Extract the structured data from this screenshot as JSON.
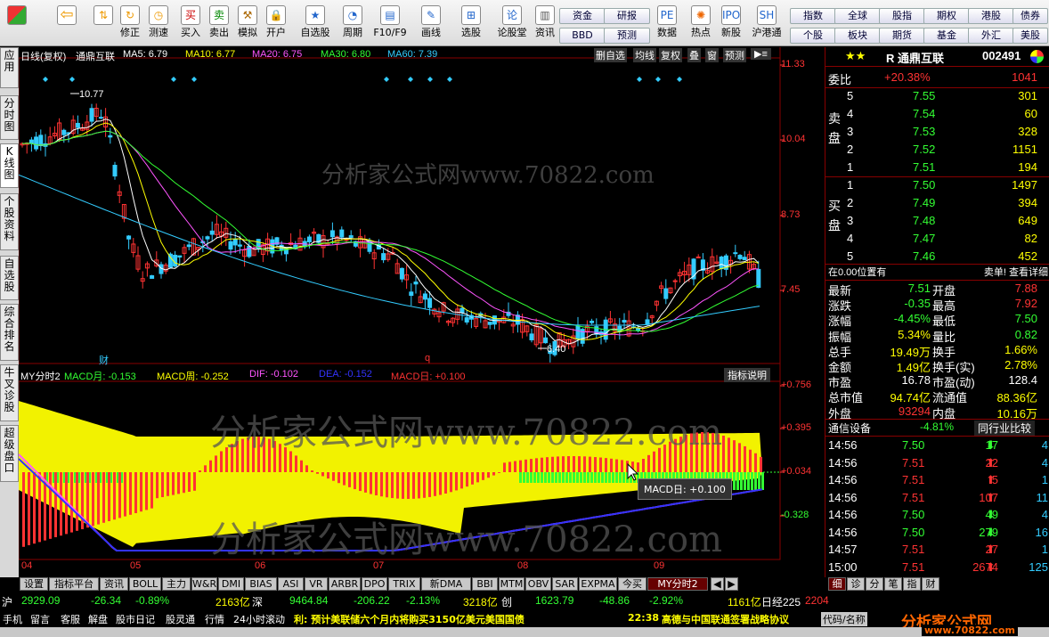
{
  "toolbar": {
    "left_buttons": [
      "修正",
      "测速",
      "买入",
      "卖出",
      "模拟",
      "开户",
      "自选股",
      "周期",
      "F10/F9",
      "画线",
      "选股",
      "论股堂",
      "资讯",
      "数据",
      "热点",
      "新股",
      "沪港通"
    ],
    "pills": [
      "资金",
      "研报",
      "BBD",
      "预测",
      "指数",
      "全球",
      "股指",
      "期权",
      "港股",
      "债券",
      "个股",
      "板块",
      "期货",
      "基金",
      "外汇",
      "美股"
    ]
  },
  "vtabs": [
    "应用",
    "分时图",
    "K线图",
    "个股资料",
    "自选股",
    "综合排名",
    "牛叉诊股",
    "超级盘口"
  ],
  "chart": {
    "header": {
      "period": "日线(复权)",
      "name": "通鼎互联",
      "ma5": "MA5: 6.79",
      "ma10": "MA10: 6.77",
      "ma20": "MA20: 6.75",
      "ma30": "MA30: 6.80",
      "ma60": "MA60: 7.39"
    },
    "toolbar": [
      "删自选",
      "均线",
      "复权",
      "叠",
      "窗",
      "预测"
    ],
    "y_labels": [
      "11.33",
      "10.04",
      "8.73",
      "7.45"
    ],
    "high_label": "10.77",
    "low_label": "6.40",
    "markers": [
      "财",
      "q"
    ],
    "ind_header": {
      "name": "MY分时2",
      "macd_month": "MACD月: -0.153",
      "macd_week": "MACD周: -0.252",
      "dif": "DIF: -0.102",
      "dea": "DEA: -0.152",
      "macd_day": "MACD日: +0.100"
    },
    "ind_btn": "指标说明",
    "ind_y": [
      "+0.756",
      "+0.395",
      "+0.034",
      "-0.328"
    ],
    "months": [
      "04",
      "05",
      "06",
      "07",
      "08",
      "09"
    ],
    "tooltip": "MACD日: +0.100",
    "watermark": "分析家公式网www.70822.com"
  },
  "chart_data": {
    "type": "candlestick",
    "title": "通鼎互联",
    "y_range": [
      6.4,
      11.33
    ],
    "months": [
      "04",
      "05",
      "06",
      "07",
      "08",
      "09"
    ],
    "high": 10.77,
    "low": 6.4,
    "ma": {
      "MA5": 6.79,
      "MA10": 6.77,
      "MA20": 6.75,
      "MA30": 6.8,
      "MA60": 7.39
    },
    "indicator": {
      "name": "MY分时2",
      "MACD月": -0.153,
      "MACD周": -0.252,
      "DIF": -0.102,
      "DEA": -0.152,
      "MACD日": 0.1,
      "y_range": [
        -0.328,
        0.756
      ]
    }
  },
  "quote": {
    "title": "R 通鼎互联",
    "code": "002491",
    "webi_label": "委比",
    "webi": "+20.38%",
    "webi_diff": "1041",
    "sell": [
      [
        "5",
        "7.55",
        "301"
      ],
      [
        "4",
        "7.54",
        "60"
      ],
      [
        "3",
        "7.53",
        "328"
      ],
      [
        "2",
        "7.52",
        "1151"
      ],
      [
        "1",
        "7.51",
        "194"
      ]
    ],
    "buy": [
      [
        "1",
        "7.50",
        "1497"
      ],
      [
        "2",
        "7.49",
        "394"
      ],
      [
        "3",
        "7.48",
        "649"
      ],
      [
        "4",
        "7.47",
        "82"
      ],
      [
        "5",
        "7.46",
        "452"
      ]
    ],
    "sell_label": "卖盘",
    "buy_label": "买盘",
    "pos_text": "在0.00位置有",
    "pos_right": "卖单! 查看详细",
    "stats": [
      [
        "最新",
        "7.51",
        "开盘",
        "7.88"
      ],
      [
        "涨跌",
        "-0.35",
        "最高",
        "7.92"
      ],
      [
        "涨幅",
        "-4.45%",
        "最低",
        "7.50"
      ],
      [
        "振幅",
        "5.34%",
        "量比",
        "0.82"
      ],
      [
        "总手",
        "19.49万",
        "换手",
        "1.66%"
      ],
      [
        "金额",
        "1.49亿",
        "换手(实)",
        "2.78%"
      ],
      [
        "市盈",
        "16.78",
        "市盈(动)",
        "128.4"
      ],
      [
        "总市值",
        "94.74亿",
        "流通值",
        "88.36亿"
      ],
      [
        "外盘",
        "93294",
        "内盘",
        "10.16万"
      ]
    ],
    "sector_label": "通信设备",
    "sector_change": "-4.81%",
    "sector_btn": "同行业比较",
    "ticks": [
      [
        "14:56",
        "7.50",
        "17",
        "4"
      ],
      [
        "14:56",
        "7.51",
        "22",
        "4"
      ],
      [
        "14:56",
        "7.51",
        "5",
        "1"
      ],
      [
        "14:56",
        "7.51",
        "107",
        "11"
      ],
      [
        "14:56",
        "7.50",
        "49",
        "4"
      ],
      [
        "14:56",
        "7.50",
        "279",
        "16"
      ],
      [
        "14:57",
        "7.51",
        "27",
        "1"
      ],
      [
        "15:00",
        "7.51",
        "2674",
        "125"
      ]
    ]
  },
  "bottom_tabs": [
    "设置",
    "指标平台",
    "资讯",
    "BOLL",
    "主力",
    "W&R",
    "DMI",
    "BIAS",
    "ASI",
    "VR",
    "ARBR",
    "DPO",
    "TRIX",
    "新DMA",
    "BBI",
    "MTM",
    "OBV",
    "SAR",
    "EXPMA",
    "今买",
    "MY分时2"
  ],
  "right_tabs": [
    "细",
    "诊",
    "分",
    "笔",
    "指",
    "财"
  ],
  "status": {
    "sh": "沪",
    "sh_val": "2929.09",
    "sh_chg": "-26.34",
    "sh_pct": "-0.89%",
    "sh_amt": "2163亿",
    "sz": "深",
    "sz_val": "9464.84",
    "sz_chg": "-206.22",
    "sz_pct": "-2.13%",
    "sz_amt": "3218亿",
    "cy": "创",
    "cy_val": "1623.79",
    "cy_chg": "-48.86",
    "cy_pct": "-2.92%",
    "cy_amt": "1161亿",
    "nk": "日经225",
    "nk_val": "2204"
  },
  "news": {
    "left": [
      "手机",
      "留言",
      "客服",
      "解盘",
      "股市日记",
      "股灵通",
      "行情",
      "24小时滚动"
    ],
    "headline": "利: 预计美联储六个月内将购买3150亿美元美国国债",
    "time": "22:38",
    "headline2": "高德与中国联通签署战略协议",
    "right": "代码/名称"
  },
  "brand": {
    "name": "分析家公式网",
    "url": "www.70822.com"
  }
}
